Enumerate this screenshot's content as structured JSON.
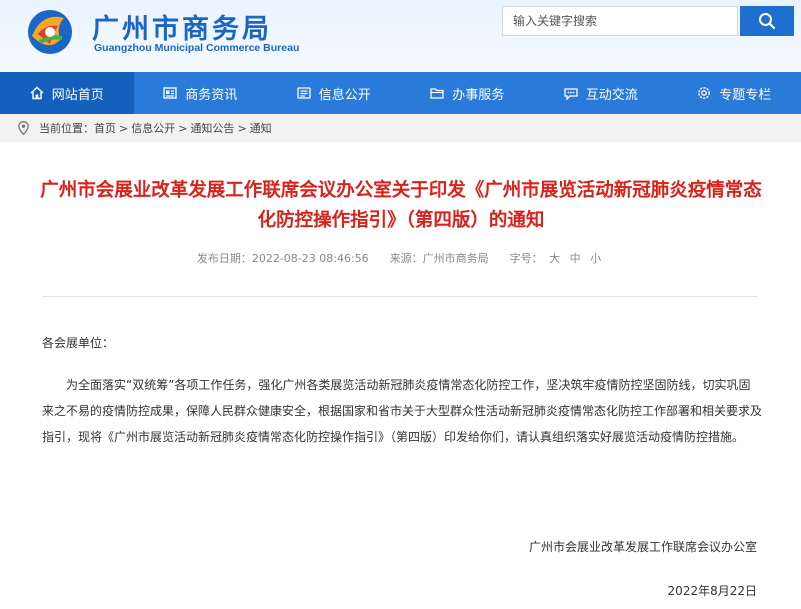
{
  "header": {
    "title": "广州市商务局",
    "subtitle": "Guangzhou Municipal Commerce Bureau",
    "search_placeholder": "输入关键字搜索"
  },
  "nav": {
    "items": [
      {
        "label": "网站首页",
        "icon": "home-icon"
      },
      {
        "label": "商务资讯",
        "icon": "news-icon"
      },
      {
        "label": "信息公开",
        "icon": "info-icon"
      },
      {
        "label": "办事服务",
        "icon": "folder-icon"
      },
      {
        "label": "互动交流",
        "icon": "chat-icon"
      },
      {
        "label": "专题专栏",
        "icon": "gear-icon"
      }
    ],
    "active_index": 0
  },
  "breadcrumb": {
    "prefix": "当前位置：",
    "items": [
      "首页",
      "信息公开",
      "通知公告",
      "通知"
    ],
    "separator": ">"
  },
  "article": {
    "title": "广州市会展业改革发展工作联席会议办公室关于印发《广州市展览活动新冠肺炎疫情常态化防控操作指引》（第四版）的通知",
    "publish_label": "发布日期：",
    "publish_date": "2022-08-23 08:46:56",
    "source_label": "来源：",
    "source": "广州市商务局",
    "font_label": "字号：",
    "font_sizes": [
      "大",
      "中",
      "小"
    ],
    "salutation": "各会展单位：",
    "paragraph": "为全面落实“双统筹”各项工作任务，强化广州各类展览活动新冠肺炎疫情常态化防控工作，坚决筑牢疫情防控坚固防线，切实巩固来之不易的疫情防控成果，保障人民群众健康安全，根据国家和省市关于大型群众性活动新冠肺炎疫情常态化防控工作部署和相关要求及指引，现将《广州市展览活动新冠肺炎疫情常态化防控操作指引》（第四版）印发给你们，请认真组织落实好展览活动疫情防控措施。",
    "signature": "广州市会展业改革发展工作联席会议办公室",
    "date": "2022年8月22日"
  },
  "colors": {
    "brand_blue": "#1a66c6",
    "nav_bg": "#2a7bd9",
    "nav_active": "#1560bd",
    "title_red": "#d9221b"
  }
}
